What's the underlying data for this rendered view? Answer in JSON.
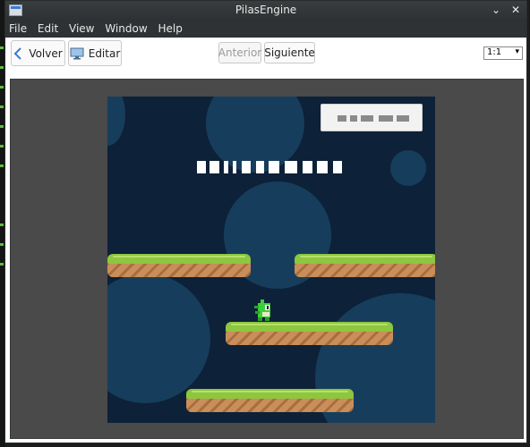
{
  "window": {
    "title": "PilasEngine"
  },
  "menu": [
    "File",
    "Edit",
    "View",
    "Window",
    "Help"
  ],
  "toolbar": {
    "back_label": "Volver",
    "edit_label": "Editar",
    "prev_label": "Anterior",
    "next_label": "Siguiente",
    "zoom_value": "1:1"
  },
  "colors": {
    "stage_background": "#0d2138",
    "bubble": "#163e5c",
    "grass": "#8dc63f",
    "dirt": "#c98e5a",
    "accent": "#3a7bd5"
  },
  "icons": {
    "back": "chevron-left-icon",
    "edit": "monitor-icon",
    "minimize": "chevron-down-icon",
    "close": "close-icon"
  }
}
